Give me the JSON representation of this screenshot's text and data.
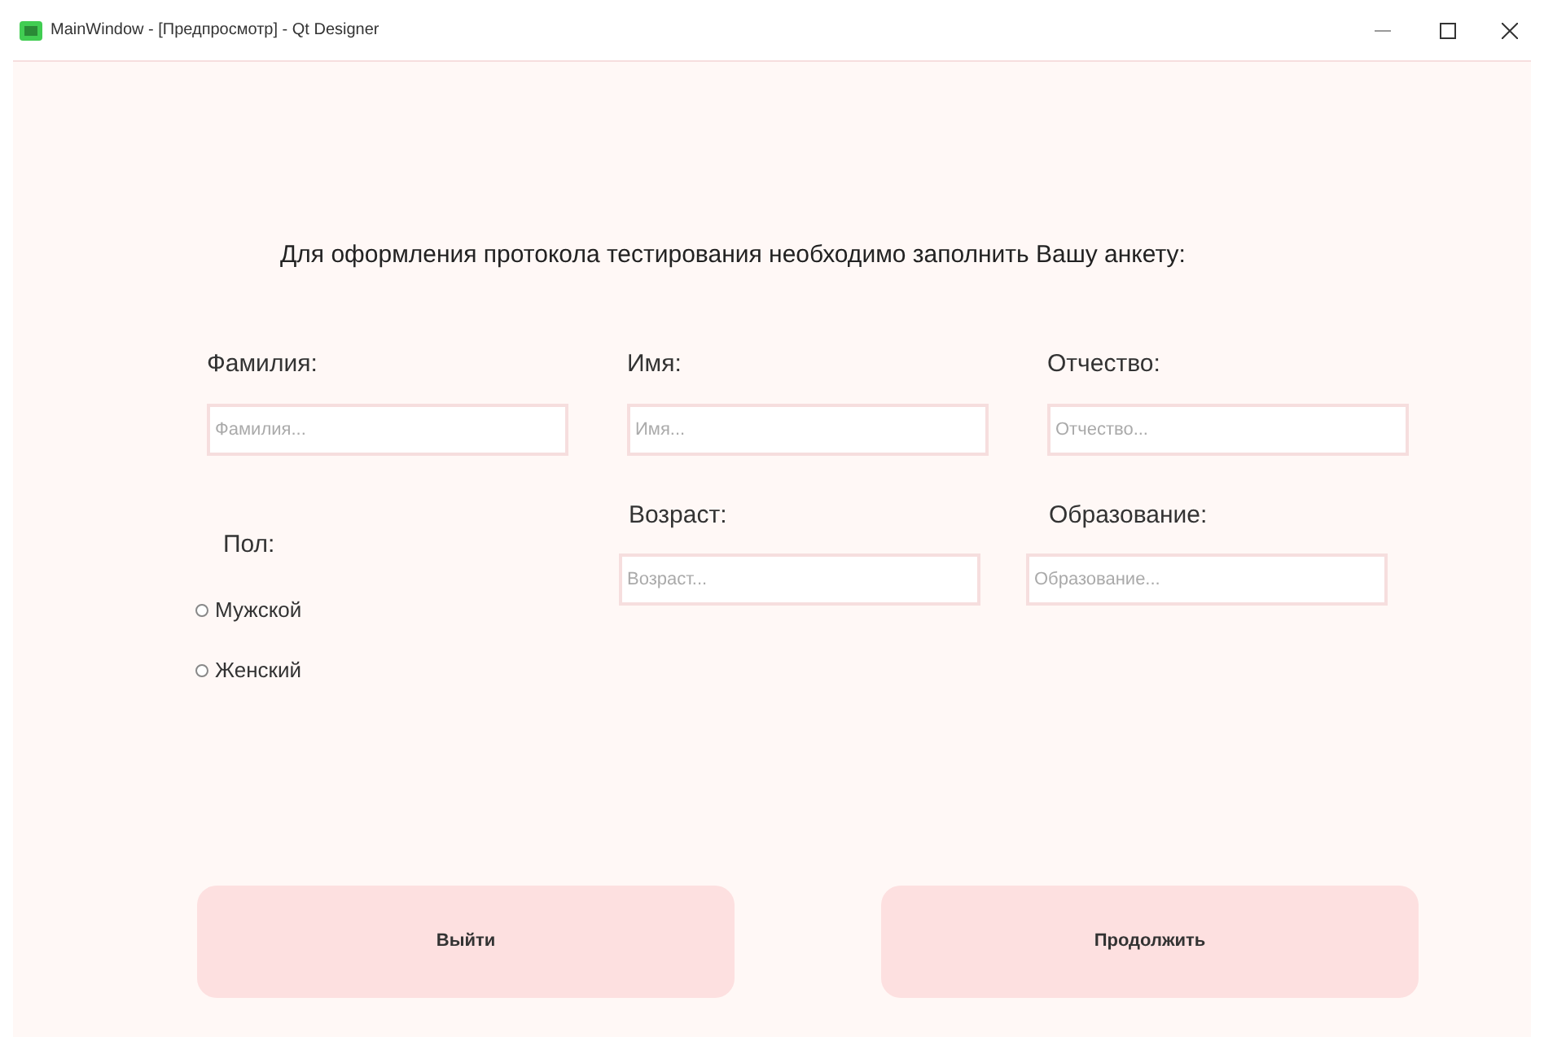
{
  "window": {
    "title": "MainWindow - [Предпросмотр] - Qt Designer"
  },
  "heading": "Для оформления протокола тестирования необходимо заполнить Вашу анкету:",
  "row1": [
    {
      "label": "Фамилия:",
      "placeholder": "Фамилия..."
    },
    {
      "label": "Имя:",
      "placeholder": "Имя..."
    },
    {
      "label": "Отчество:",
      "placeholder": "Отчество..."
    }
  ],
  "gender": {
    "label": "Пол:",
    "options": [
      {
        "label": "Мужской",
        "checked": false
      },
      {
        "label": "Женский",
        "checked": false
      }
    ]
  },
  "row2": [
    {
      "label": "Возраст:",
      "placeholder": "Возраст..."
    },
    {
      "label": "Образование:",
      "placeholder": "Образование..."
    }
  ],
  "buttons": [
    "Выйти",
    "Продолжить"
  ]
}
